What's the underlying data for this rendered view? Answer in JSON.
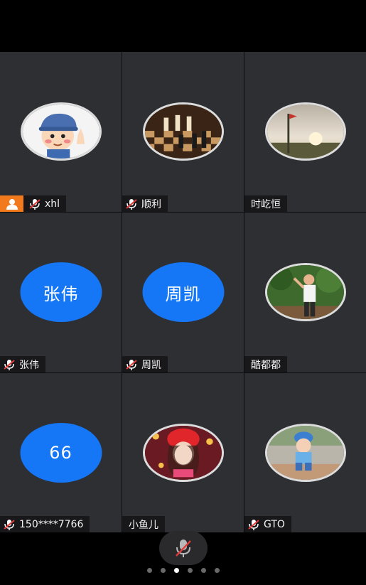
{
  "participants": [
    {
      "name": "xhl",
      "avatar": "cartoon-boy-avatar",
      "host": true,
      "mic": "muted"
    },
    {
      "name": "顺利",
      "avatar": "chess-board-avatar",
      "host": false,
      "mic": "muted"
    },
    {
      "name": "时屹恒",
      "avatar": "landscape-flag-avatar",
      "host": false,
      "mic": "none"
    },
    {
      "name": "张伟",
      "initials": "张伟",
      "host": false,
      "mic": "muted"
    },
    {
      "name": "周凯",
      "initials": "周凯",
      "host": false,
      "mic": "muted"
    },
    {
      "name": "酷都都",
      "avatar": "man-in-garden-avatar",
      "host": false,
      "mic": "none"
    },
    {
      "name": "150****7766",
      "initials": "66",
      "host": false,
      "mic": "muted"
    },
    {
      "name": "小鱼儿",
      "avatar": "girl-red-hat-avatar",
      "host": false,
      "mic": "none"
    },
    {
      "name": "GTO",
      "avatar": "child-blue-cap-avatar",
      "host": false,
      "mic": "muted"
    }
  ],
  "controls": {
    "mic_button": "muted-microphone-icon"
  },
  "pagination": {
    "pages": 6,
    "current": 3
  },
  "colors": {
    "tile_bg": "#2e2f33",
    "initials_bg": "#1577f5",
    "host_badge": "#f27a1c",
    "mute_red": "#e23a3a"
  }
}
